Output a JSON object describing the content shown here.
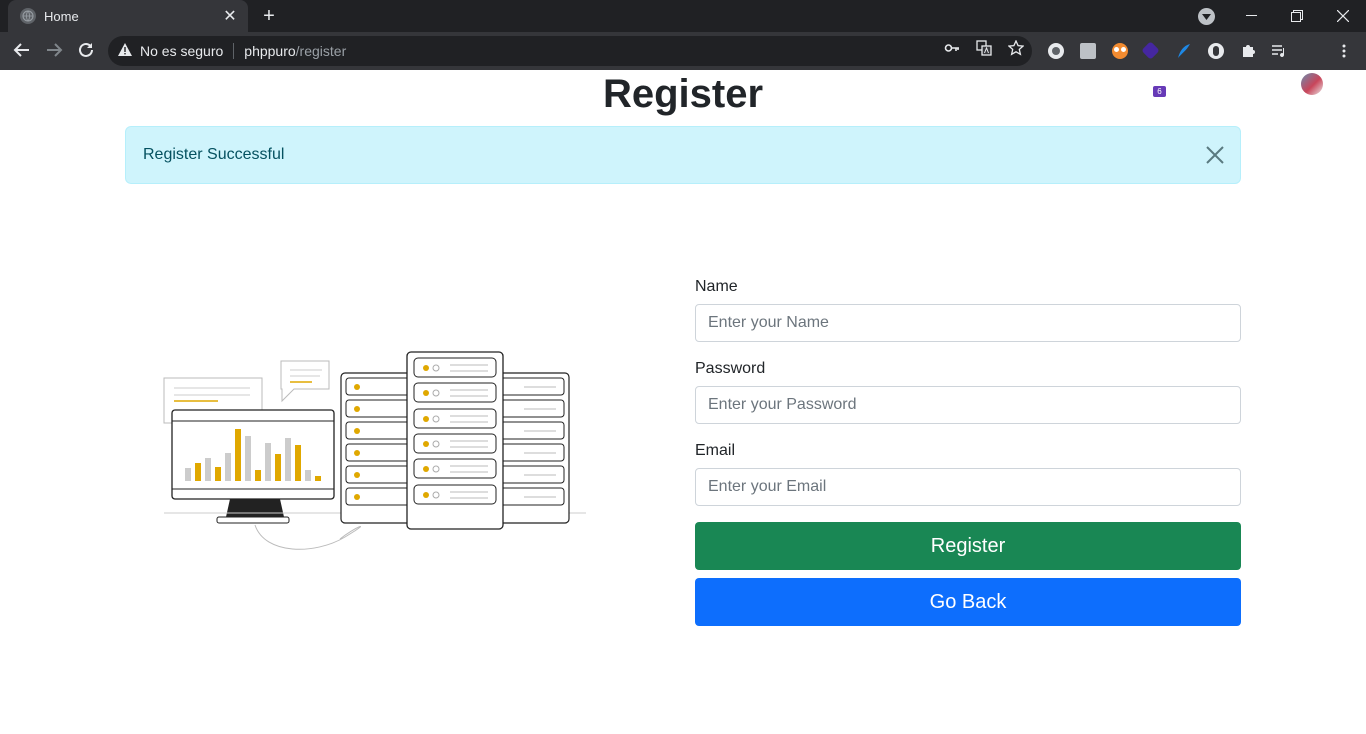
{
  "browser": {
    "tab_title": "Home",
    "tab_close": "✕",
    "new_tab": "+",
    "security_label": "No es seguro",
    "url_host": "phppuro",
    "url_path": "/register",
    "extension_badge": "6"
  },
  "page": {
    "title": "Register",
    "alert": {
      "message": "Register Successful",
      "color": "#cff4fc"
    }
  },
  "form": {
    "name_label": "Name",
    "name_placeholder": "Enter your Name",
    "password_label": "Password",
    "password_placeholder": "Enter your Password",
    "email_label": "Email",
    "email_placeholder": "Enter your Email",
    "register_label": "Register",
    "register_color": "#198754",
    "back_label": "Go Back",
    "back_color": "#0d6efd"
  }
}
